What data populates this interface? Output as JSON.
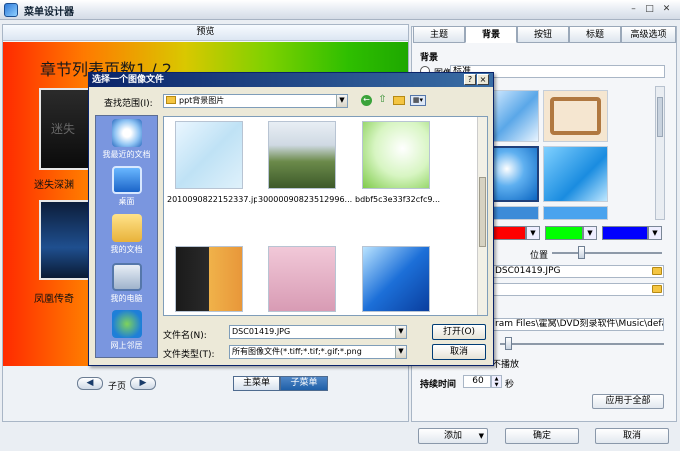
{
  "window": {
    "title": "菜单设计器"
  },
  "preview": {
    "header": "预览",
    "chapter_title": "章节列表页数1 / 2",
    "items": [
      {
        "label": "迷失深渊"
      },
      {
        "label": "凤凰传奇"
      }
    ],
    "page_label": "子页",
    "prev_icon": "chevron-left-icon",
    "next_icon": "chevron-right-icon",
    "main_menu_tab": "主菜单",
    "sub_menu_tab": "子菜单"
  },
  "right_panel": {
    "tabs": [
      "主题",
      "背景",
      "按钮",
      "标题",
      "高级选项"
    ],
    "active_tab": "背景",
    "section_label": "背景",
    "image_option": "图像",
    "image_option_value": "标准",
    "position_label": "位置",
    "bg_file": "DSC01419.JPG",
    "music_path": "ram Files\\霍窝\\DVD刻录软件\\Music\\defa",
    "loop_label": "不播放",
    "duration_label": "持续时间",
    "duration_value": "60",
    "duration_unit": "秒",
    "apply_all_button": "应用于全部",
    "colors": {
      "swatch1": "#ff0000",
      "swatch2": "#00ff00",
      "swatch3": "#0000ff",
      "accent": "#1f5fa8"
    }
  },
  "footer": {
    "add_button": "添加",
    "ok_button": "确定",
    "cancel_button": "取消"
  },
  "dialog": {
    "title": "选择一个图像文件",
    "look_in_label": "查找范围(I):",
    "look_in_value": "ppt背景图片",
    "places": [
      "我最近的文档",
      "桌面",
      "我的文档",
      "我的电脑",
      "网上邻居"
    ],
    "files": [
      {
        "name": "2010090822152337.jpg"
      },
      {
        "name": "30000090823512996..."
      },
      {
        "name": "bdbf5c3e33f32cfc9..."
      },
      {
        "name": ""
      },
      {
        "name": ""
      },
      {
        "name": ""
      }
    ],
    "filename_label": "文件名(N):",
    "filename_value": "DSC01419.JPG",
    "filetype_label": "文件类型(T):",
    "filetype_value": "所有图像文件(*.tiff;*.tif;*.gif;*.png",
    "open_button": "打开(O)",
    "cancel_button": "取消",
    "help_button": "?",
    "close_button": "×"
  }
}
